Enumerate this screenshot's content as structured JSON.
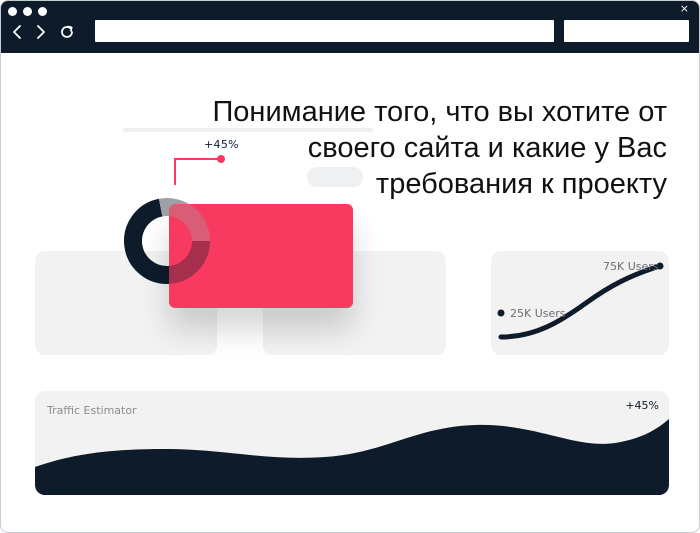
{
  "window": {
    "dots": [
      "dot",
      "dot",
      "dot"
    ],
    "close_glyph": "×",
    "back_icon": "chevron-left-icon",
    "forward_icon": "chevron-right-icon",
    "reload_icon": "reload-icon",
    "address_value": "",
    "search_value": ""
  },
  "hero": {
    "headline_line1": "Понимание того, что вы хотите от",
    "headline_line2": "своего сайта и какие у Вас",
    "headline_line3": "требования к проекту"
  },
  "donut_widget": {
    "change_label": "+45%",
    "segments": [
      {
        "name": "filled",
        "fraction": 0.72,
        "color": "#0d1b2a"
      },
      {
        "name": "remaining",
        "fraction": 0.28,
        "color": "#9ea1a5"
      }
    ],
    "accent_color": "#f83a61"
  },
  "users_widget": {
    "high_label": "75K Users",
    "low_label": "25K Users",
    "line_color": "#0d1b2a"
  },
  "traffic_widget": {
    "title": "Traffic Estimator",
    "change_label": "+45%",
    "wave_color": "#0d1b2a"
  },
  "colors": {
    "chrome": "#0d1b2a",
    "accent": "#f83a61",
    "card": "#f2f2f2"
  }
}
